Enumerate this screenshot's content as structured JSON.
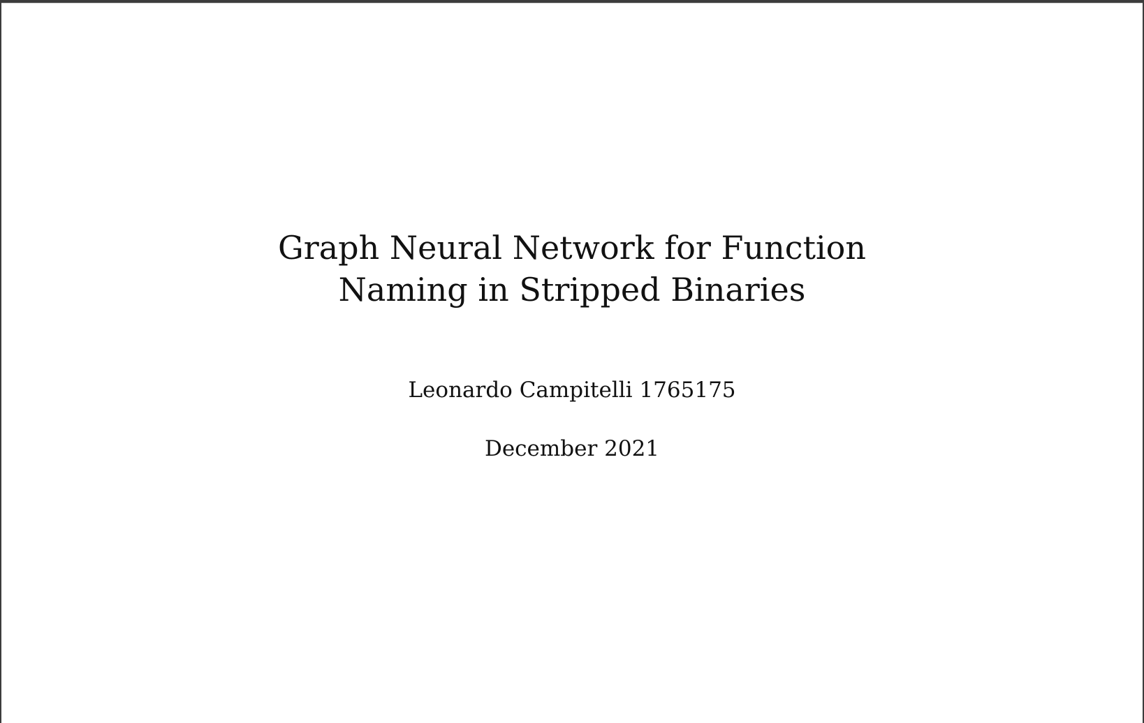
{
  "document": {
    "title_lines": [
      "Graph Neural Network for Function",
      "Naming in Stripped Binaries"
    ],
    "author": "Leonardo Campitelli 1765175",
    "date": "December 2021"
  }
}
